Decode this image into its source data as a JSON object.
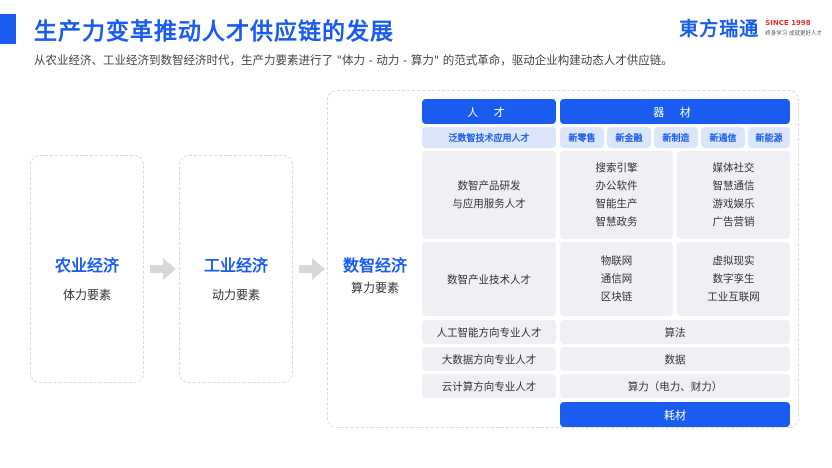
{
  "header": {
    "title": "生产力变革推动人才供应链的发展",
    "subtitle": "从农业经济、工业经济到数智经济时代，生产力要素进行了 \"体力 - 动力 - 算力\" 的范式革命，驱动企业构建动态人才供应链。"
  },
  "logo": {
    "name": "東方瑞通",
    "since": "SINCE 1998",
    "tagline": "终身学习 成就更好人才"
  },
  "stages": [
    {
      "title": "农业经济",
      "sub": "体力要素"
    },
    {
      "title": "工业经济",
      "sub": "动力要素"
    },
    {
      "title": "数智经济",
      "sub": "算力要素"
    }
  ],
  "table": {
    "head_talent": "人 才",
    "head_material": "器 材",
    "talent_tag": "泛数智技术应用人才",
    "material_tags": [
      "新零售",
      "新金融",
      "新制造",
      "新通信",
      "新能源"
    ],
    "row1": {
      "talent": [
        "数智产品研发",
        "与应用服务人才"
      ],
      "mat_left": [
        "搜索引擎",
        "办公软件",
        "智能生产",
        "智慧政务"
      ],
      "mat_right": [
        "媒体社交",
        "智慧通信",
        "游戏娱乐",
        "广告营销"
      ]
    },
    "row2": {
      "talent": "数智产业技术人才",
      "mat_left": [
        "物联网",
        "通信网",
        "区块链"
      ],
      "mat_right": [
        "虚拟现实",
        "数字孪生",
        "工业互联网"
      ]
    },
    "rows": [
      {
        "talent": "人工智能方向专业人才",
        "material": "算法"
      },
      {
        "talent": "大数据方向专业人才",
        "material": "数据"
      },
      {
        "talent": "云计算方向专业人才",
        "material": "算力（电力、财力）"
      }
    ],
    "footer": "耗材"
  },
  "colors": {
    "accent": "#1a5cf0",
    "light_blue": "#dbe6fb",
    "cell_bg": "#eef0f3",
    "logo_red": "#e03030"
  }
}
